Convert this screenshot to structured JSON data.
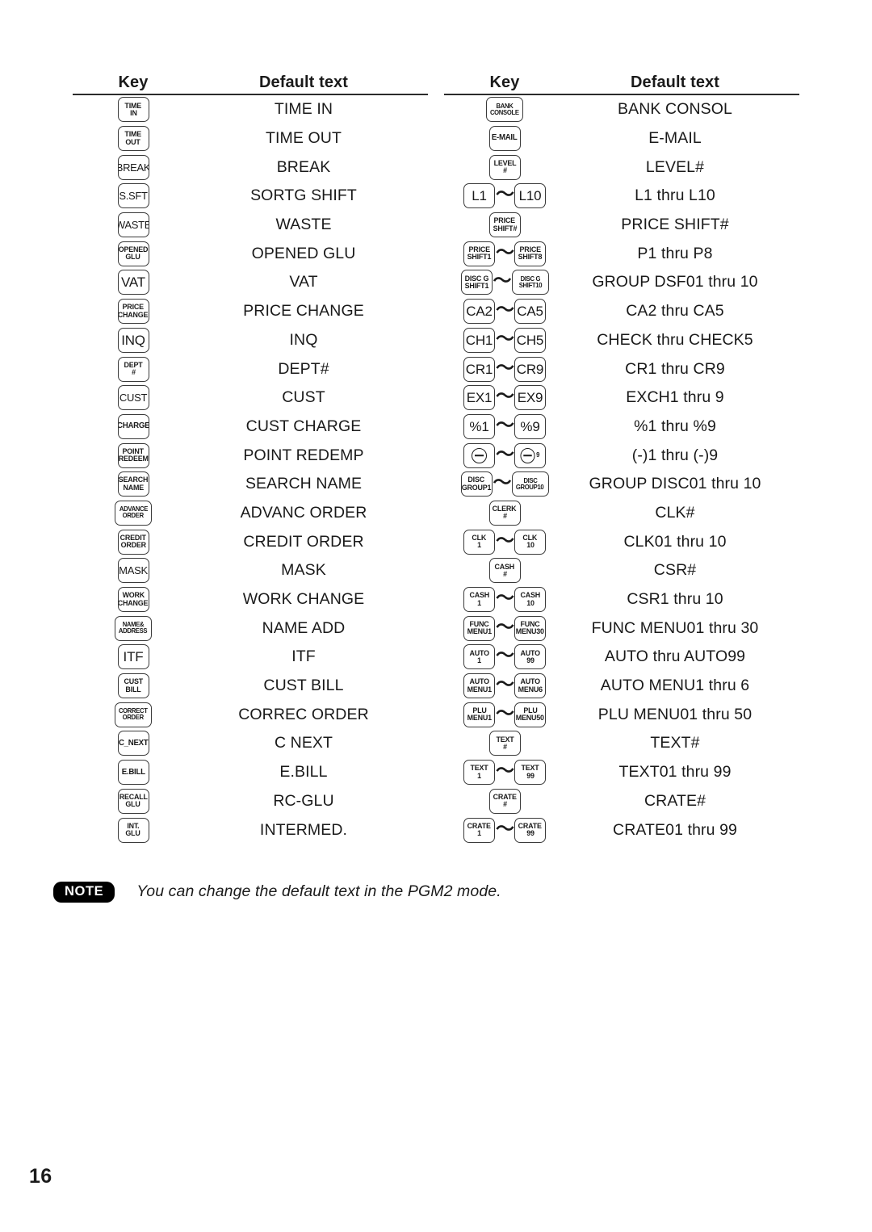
{
  "page": {
    "number": "16"
  },
  "table": {
    "header": {
      "key": "Key",
      "default_text": "Default text"
    }
  },
  "note": {
    "badge": "NOTE",
    "text": "You can change the default text in the PGM2 mode."
  },
  "left_rows": [
    {
      "key": [
        "TIME",
        "IN"
      ],
      "text": "TIME IN"
    },
    {
      "key": [
        "TIME",
        "OUT"
      ],
      "text": "TIME OUT"
    },
    {
      "key": [
        "BREAK"
      ],
      "text": "BREAK"
    },
    {
      "key": [
        "S.SFT"
      ],
      "text": "SORTG SHIFT"
    },
    {
      "key": [
        "WASTE"
      ],
      "text": "WASTE"
    },
    {
      "key": [
        "OPENED",
        "GLU"
      ],
      "text": "OPENED GLU"
    },
    {
      "key": [
        "VAT"
      ],
      "text": "VAT"
    },
    {
      "key": [
        "PRICE",
        "CHANGE"
      ],
      "text": "PRICE CHANGE"
    },
    {
      "key": [
        "INQ"
      ],
      "text": "INQ"
    },
    {
      "key": [
        "DEPT",
        "#"
      ],
      "text": "DEPT#"
    },
    {
      "key": [
        "CUST"
      ],
      "text": "CUST"
    },
    {
      "key": [
        "CHARGE"
      ],
      "text": "CUST CHARGE"
    },
    {
      "key": [
        "POINT",
        "REDEEM"
      ],
      "text": "POINT REDEMP"
    },
    {
      "key": [
        "SEARCH",
        "NAME"
      ],
      "text": "SEARCH NAME"
    },
    {
      "key": [
        "ADVANCE",
        "ORDER"
      ],
      "text": "ADVANC ORDER"
    },
    {
      "key": [
        "CREDIT",
        "ORDER"
      ],
      "text": "CREDIT ORDER"
    },
    {
      "key": [
        "MASK"
      ],
      "text": "MASK"
    },
    {
      "key": [
        "WORK",
        "CHANGE"
      ],
      "text": "WORK CHANGE"
    },
    {
      "key": [
        "NAME&",
        "ADDRESS"
      ],
      "text": "NAME ADD"
    },
    {
      "key": [
        "ITF"
      ],
      "text": "ITF"
    },
    {
      "key": [
        "CUST",
        "BILL"
      ],
      "text": "CUST BILL"
    },
    {
      "key": [
        "CORRECT",
        "ORDER"
      ],
      "text": "CORREC ORDER"
    },
    {
      "key": [
        "C_NEXT"
      ],
      "text": "C NEXT"
    },
    {
      "key": [
        "E.BILL"
      ],
      "text": "E.BILL"
    },
    {
      "key": [
        "RECALL",
        "GLU"
      ],
      "text": "RC-GLU"
    },
    {
      "key": [
        "INT.",
        "GLU"
      ],
      "text": "INTERMED."
    }
  ],
  "right_rows": [
    {
      "key": [
        "BANK",
        "CONSOLE"
      ],
      "text": "BANK CONSOL"
    },
    {
      "key": [
        "E-MAIL"
      ],
      "text": "E-MAIL"
    },
    {
      "key": [
        "LEVEL",
        "#"
      ],
      "text": "LEVEL#"
    },
    {
      "key": [
        "L1"
      ],
      "key2": [
        "L10"
      ],
      "text": "L1 thru L10"
    },
    {
      "key": [
        "PRICE",
        "SHIFT#"
      ],
      "text": "PRICE SHIFT#"
    },
    {
      "key": [
        "PRICE",
        "SHIFT1"
      ],
      "key2": [
        "PRICE",
        "SHIFT8"
      ],
      "text": "P1 thru P8"
    },
    {
      "key": [
        "DISC G",
        "SHIFT1"
      ],
      "key2": [
        "DISC G",
        "SHIFT10"
      ],
      "text": "GROUP DSF01 thru 10"
    },
    {
      "key": [
        "CA2"
      ],
      "key2": [
        "CA5"
      ],
      "text": "CA2 thru CA5"
    },
    {
      "key": [
        "CH1"
      ],
      "key2": [
        "CH5"
      ],
      "text": "CHECK thru CHECK5"
    },
    {
      "key": [
        "CR1"
      ],
      "key2": [
        "CR9"
      ],
      "text": "CR1 thru CR9"
    },
    {
      "key": [
        "EX1"
      ],
      "key2": [
        "EX9"
      ],
      "text": "EXCH1 thru 9"
    },
    {
      "key": [
        "%1"
      ],
      "key2": [
        "%9"
      ],
      "text": "%1 thru %9"
    },
    {
      "key": [
        "minus-circle"
      ],
      "key2": [
        "minus-circle",
        "9"
      ],
      "text": "(-)1 thru (-)9"
    },
    {
      "key": [
        "DISC",
        "GROUP1"
      ],
      "key2": [
        "DISC",
        "GROUP10"
      ],
      "text": "GROUP DISC01 thru 10"
    },
    {
      "key": [
        "CLERK",
        "#"
      ],
      "text": "CLK#"
    },
    {
      "key": [
        "CLK",
        "1"
      ],
      "key2": [
        "CLK",
        "10"
      ],
      "text": "CLK01 thru 10"
    },
    {
      "key": [
        "CASH",
        "#"
      ],
      "text": "CSR#"
    },
    {
      "key": [
        "CASH",
        "1"
      ],
      "key2": [
        "CASH",
        "10"
      ],
      "text": "CSR1 thru 10"
    },
    {
      "key": [
        "FUNC",
        "MENU1"
      ],
      "key2": [
        "FUNC",
        "MENU30"
      ],
      "text": "FUNC MENU01 thru 30"
    },
    {
      "key": [
        "AUTO",
        "1"
      ],
      "key2": [
        "AUTO",
        "99"
      ],
      "text": "AUTO thru AUTO99"
    },
    {
      "key": [
        "AUTO",
        "MENU1"
      ],
      "key2": [
        "AUTO",
        "MENU6"
      ],
      "text": "AUTO MENU1 thru 6"
    },
    {
      "key": [
        "PLU",
        "MENU1"
      ],
      "key2": [
        "PLU",
        "MENU50"
      ],
      "text": "PLU MENU01 thru 50"
    },
    {
      "key": [
        "TEXT",
        "#"
      ],
      "text": "TEXT#"
    },
    {
      "key": [
        "TEXT",
        "1"
      ],
      "key2": [
        "TEXT",
        "99"
      ],
      "text": "TEXT01 thru 99"
    },
    {
      "key": [
        "CRATE",
        "#"
      ],
      "text": "CRATE#"
    },
    {
      "key": [
        "CRATE",
        "1"
      ],
      "key2": [
        "CRATE",
        "99"
      ],
      "text": "CRATE01 thru 99"
    }
  ],
  "separator": "〜"
}
